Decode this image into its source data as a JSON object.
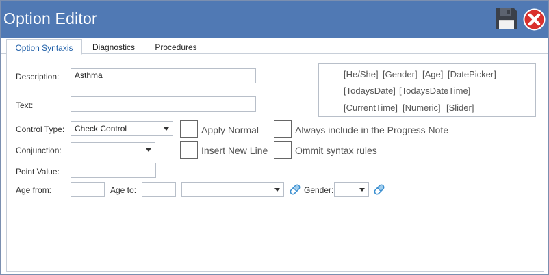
{
  "window": {
    "title": "Option Editor"
  },
  "icons": {
    "save": "floppy-disk-icon",
    "close": "close-circle-icon",
    "clear": "eraser-icon"
  },
  "colors": {
    "titlebar": "#5079b4",
    "close": "#d9302c",
    "clear": "#3b8fd0"
  },
  "tabs": [
    {
      "label": "Option Syntaxis",
      "active": true
    },
    {
      "label": "Diagnostics",
      "active": false
    },
    {
      "label": "Procedures",
      "active": false
    }
  ],
  "form": {
    "description": {
      "label": "Description:",
      "value": "Asthma"
    },
    "text": {
      "label": "Text:",
      "value": ""
    },
    "control_type": {
      "label": "Control Type:",
      "value": "Check Control"
    },
    "conjunction": {
      "label": "Conjunction:",
      "value": ""
    },
    "point_value": {
      "label": "Point Value:",
      "value": ""
    },
    "age_from": {
      "label": "Age from:",
      "value": ""
    },
    "age_to": {
      "label": "Age to:",
      "value": ""
    },
    "age_unit": {
      "value": ""
    },
    "gender": {
      "label": "Gender:",
      "value": ""
    }
  },
  "checkboxes": {
    "apply_normal": {
      "label": "Apply Normal",
      "checked": false
    },
    "insert_new_line": {
      "label": "Insert New Line",
      "checked": false
    },
    "always_include": {
      "label": "Always include in the Progress Note",
      "checked": false
    },
    "ommit_syntax": {
      "label": "Ommit syntax rules",
      "checked": false
    }
  },
  "tokens": {
    "he_she": "[He/She]",
    "gender": "[Gender]",
    "age": "[Age]",
    "datepicker": "[DatePicker]",
    "todays_date": "[TodaysDate]",
    "todays_datetime": "[TodaysDateTime]",
    "current_time": "[CurrentTime]",
    "numeric": "[Numeric]",
    "slider": "[Slider]"
  }
}
